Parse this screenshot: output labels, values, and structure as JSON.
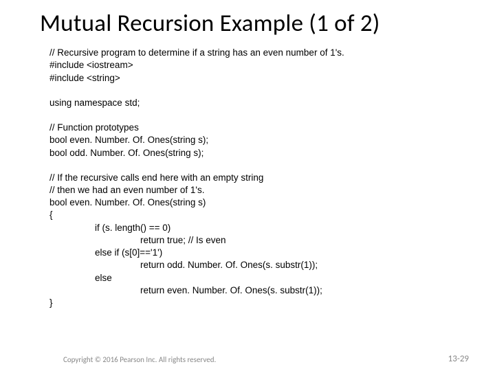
{
  "title": "Mutual Recursion Example (1 of 2)",
  "code": {
    "l01": "// Recursive program to determine if a string has an even number of 1's.",
    "l02": "#include <iostream>",
    "l03": "#include <string>",
    "l04": "using namespace std;",
    "l05": "// Function prototypes",
    "l06": "bool even. Number. Of. Ones(string s);",
    "l07": "bool odd. Number. Of. Ones(string s);",
    "l08": "// If the recursive calls end here with an empty string",
    "l09": "// then we had an even number of 1's.",
    "l10": "bool even. Number. Of. Ones(string s)",
    "l11": "{",
    "l12": "if (s. length() == 0)",
    "l13": "return true; // Is even",
    "l14": "else if (s[0]=='1')",
    "l15": "return odd. Number. Of. Ones(s. substr(1));",
    "l16": "else",
    "l17": "return even. Number. Of. Ones(s. substr(1));",
    "l18": "}"
  },
  "footer": {
    "copyright": "Copyright © 2016 Pearson Inc. All rights reserved.",
    "pageno": "13-29"
  }
}
